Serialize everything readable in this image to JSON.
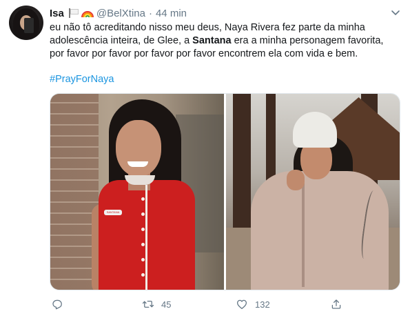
{
  "tweet": {
    "display_name": "Isa",
    "handle": "@BelXtina",
    "separator": "·",
    "timestamp": "44 min",
    "text_lines": [
      "eu não tô acreditando nisso meu deus, Naya Rivera fez parte da minha",
      "adolescência inteira, de Glee, a ",
      "Santana",
      " era a minha personagem favorita,",
      "por favor por favor por favor por favor encontrem ela com vida e bem."
    ],
    "hashtag": "#PrayForNaya",
    "emojis": [
      "white-flag-icon",
      "rainbow-icon"
    ],
    "photo_left_badge": "SANTANA",
    "actions": {
      "reply_icon": "reply-icon",
      "retweet_icon": "retweet-icon",
      "retweet_count": "45",
      "like_icon": "heart-icon",
      "like_count": "132",
      "share_icon": "share-icon"
    }
  },
  "colors": {
    "text": "#14171a",
    "secondary": "#657786",
    "link": "#1b95e0"
  }
}
